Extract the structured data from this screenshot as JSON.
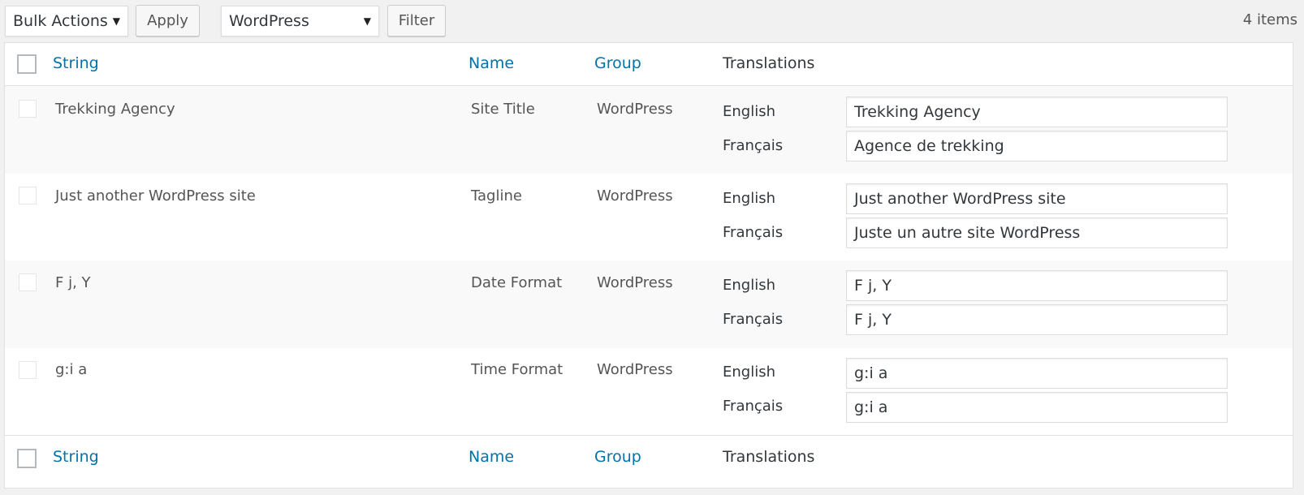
{
  "toolbar": {
    "bulk_actions": "Bulk Actions",
    "apply": "Apply",
    "group_filter": "WordPress",
    "filter": "Filter",
    "items_count": "4 items"
  },
  "table": {
    "columns": {
      "string": "String",
      "name": "Name",
      "group": "Group",
      "translations": "Translations"
    },
    "rows": [
      {
        "string": "Trekking Agency",
        "name": "Site Title",
        "group": "WordPress",
        "translations": [
          {
            "lang": "English",
            "value": "Trekking Agency"
          },
          {
            "lang": "Français",
            "value": "Agence de trekking"
          }
        ]
      },
      {
        "string": "Just another WordPress site",
        "name": "Tagline",
        "group": "WordPress",
        "translations": [
          {
            "lang": "English",
            "value": "Just another WordPress site"
          },
          {
            "lang": "Français",
            "value": "Juste un autre site WordPress"
          }
        ]
      },
      {
        "string": "F j, Y",
        "name": "Date Format",
        "group": "WordPress",
        "translations": [
          {
            "lang": "English",
            "value": "F j, Y"
          },
          {
            "lang": "Français",
            "value": "F j, Y"
          }
        ]
      },
      {
        "string": "g:i a",
        "name": "Time Format",
        "group": "WordPress",
        "translations": [
          {
            "lang": "English",
            "value": "g:i a"
          },
          {
            "lang": "Français",
            "value": "g:i a"
          }
        ]
      }
    ]
  },
  "colors": {
    "link": "#0073aa",
    "row_alt": "#f9f9f9",
    "background": "#f1f1f1"
  }
}
